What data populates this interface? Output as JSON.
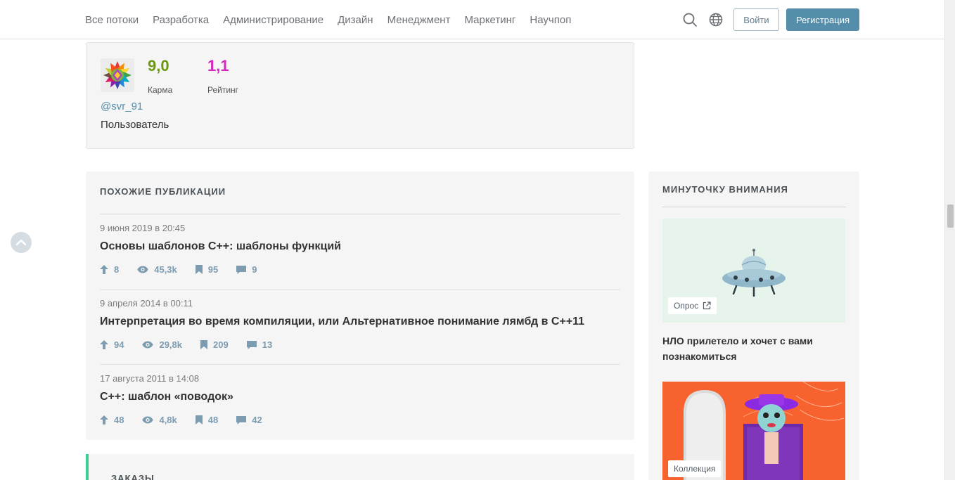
{
  "header": {
    "nav": [
      "Все потоки",
      "Разработка",
      "Администрирование",
      "Дизайн",
      "Менеджмент",
      "Маркетинг",
      "Научпоп"
    ],
    "login_label": "Войти",
    "register_label": "Регистрация",
    "icons": [
      "search-icon",
      "globe-icon"
    ]
  },
  "author": {
    "karma_value": "9,0",
    "karma_label": "Карма",
    "rating_value": "1,1",
    "rating_label": "Рейтинг",
    "nickname": "@svr_91",
    "role": "Пользователь",
    "colors": {
      "karma": "#6c9712",
      "rating": "#d428c0",
      "link": "#548eaa"
    }
  },
  "similar": {
    "title": "ПОХОЖИЕ ПУБЛИКАЦИИ",
    "items": [
      {
        "date": "9 июня 2019 в 20:45",
        "title": "Основы шаблонов С++: шаблоны функций",
        "votes": "8",
        "views": "45,3k",
        "bookmarks": "95",
        "comments": "9"
      },
      {
        "date": "9 апреля 2014 в 00:11",
        "title": "Интерпретация во время компиляции, или Альтернативное понимание лямбд в C++11",
        "votes": "94",
        "views": "29,8k",
        "bookmarks": "209",
        "comments": "13"
      },
      {
        "date": "17 августа 2011 в 14:08",
        "title": "C++: шаблон «поводок»",
        "votes": "48",
        "views": "4,8k",
        "bookmarks": "48",
        "comments": "42"
      }
    ]
  },
  "orders": {
    "title": "ЗАКАЗЫ"
  },
  "sidebar": {
    "title": "МИНУТОЧКУ ВНИМАНИЯ",
    "promo1": {
      "tag": "Опрос",
      "title": "НЛО прилетело и хочет с вами познакомиться"
    },
    "promo2": {
      "tag": "Коллекция"
    }
  }
}
